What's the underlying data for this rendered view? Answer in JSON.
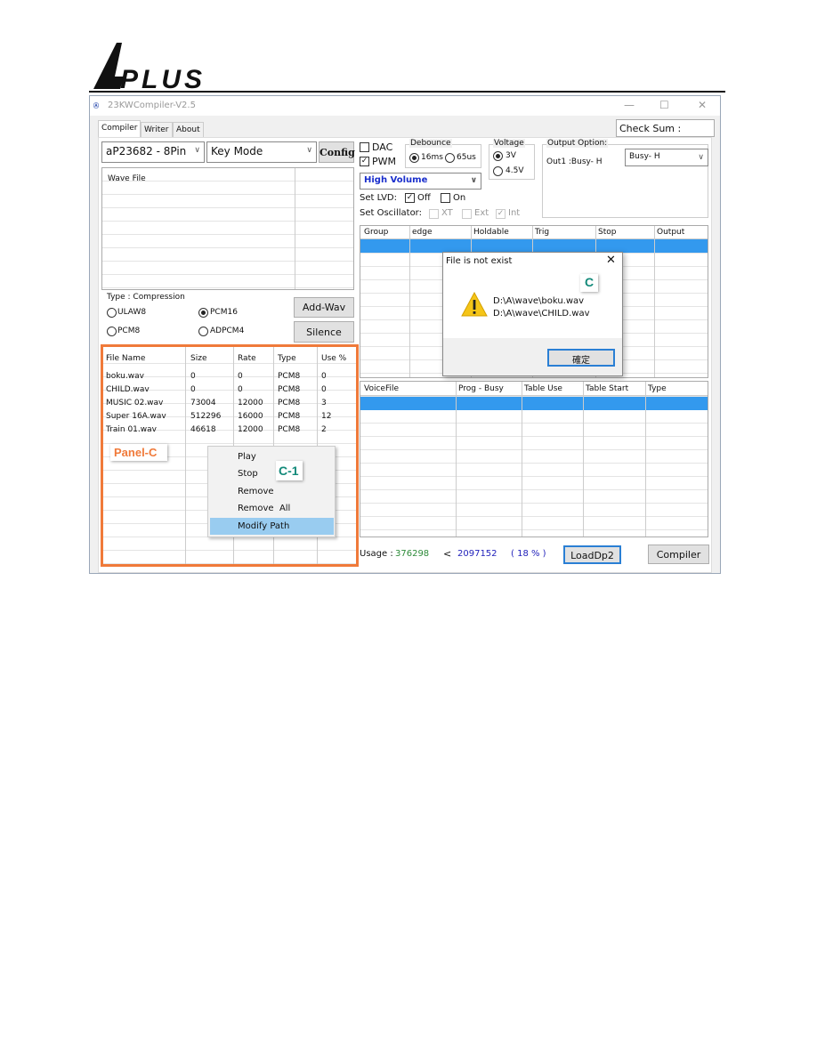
{
  "logo_text": "APLUS",
  "window": {
    "title": "23KWCompiler-V2.5",
    "minimize": "—",
    "maximize": "☐",
    "close": "✕"
  },
  "tabs": [
    {
      "label": "Compiler",
      "active": true
    },
    {
      "label": "Writer"
    },
    {
      "label": "About"
    }
  ],
  "check_sum_label": "Check Sum :",
  "chip_combo": "aP23682 - 8Pin",
  "mode_combo": "Key Mode",
  "config_label": "Config",
  "wave_file_header": "Wave File",
  "compression": {
    "title": "Type : Compression",
    "options": [
      {
        "label": "ULAW8",
        "checked": false
      },
      {
        "label": "PCM16",
        "checked": true
      },
      {
        "label": "PCM8",
        "checked": false
      },
      {
        "label": "ADPCM4",
        "checked": false
      }
    ]
  },
  "add_wav_label": "Add-Wav",
  "silence_label": "Silence",
  "file_table": {
    "headers": [
      "File Name",
      "Size",
      "Rate",
      "Type",
      "Use %"
    ],
    "rows": [
      [
        "boku.wav",
        "0",
        "0",
        "PCM8",
        "0"
      ],
      [
        "CHILD.wav",
        "0",
        "0",
        "PCM8",
        "0"
      ],
      [
        "MUSIC 02.wav",
        "73004",
        "12000",
        "PCM8",
        "3"
      ],
      [
        "Super 16A.wav",
        "512296",
        "16000",
        "PCM8",
        "12"
      ],
      [
        "Train 01.wav",
        "46618",
        "12000",
        "PCM8",
        "2"
      ]
    ]
  },
  "panel_c_tag": "Panel-C",
  "c1_tag": "C-1",
  "context_menu": [
    "Play",
    "Stop",
    "Remove",
    "Remove  All",
    "Modify Path"
  ],
  "context_menu_highlighted": "Modify Path",
  "dac": {
    "label": "DAC",
    "checked": false
  },
  "pwm": {
    "label": "PWM",
    "checked": true
  },
  "debounce": {
    "title": "Debounce",
    "options": [
      {
        "label": "16ms",
        "checked": true
      },
      {
        "label": "65us",
        "checked": false
      }
    ]
  },
  "voltage": {
    "title": "Voltage",
    "options": [
      {
        "label": "3V",
        "checked": true
      },
      {
        "label": "4.5V",
        "checked": false
      }
    ]
  },
  "output_option": {
    "title": "Output Option:",
    "out1": "Out1 :Busy- H",
    "combo": "Busy- H"
  },
  "volume_combo": "High Volume",
  "lvd": {
    "label": "Set LVD:",
    "off": "Off",
    "off_checked": true,
    "on": "On",
    "on_checked": false
  },
  "oscillator": {
    "label": "Set Oscillator:",
    "options": [
      {
        "label": "XT",
        "checked": false
      },
      {
        "label": "Ext",
        "checked": false
      },
      {
        "label": "Int",
        "checked": true
      }
    ]
  },
  "key_table": {
    "headers": [
      "Group",
      "edge",
      "Holdable",
      "Trig",
      "Stop",
      "Output"
    ]
  },
  "voice_table": {
    "headers": [
      "VoiceFile",
      "Prog - Busy",
      "Table Use",
      "Table Start",
      "Type"
    ]
  },
  "dialog": {
    "title": "File is not exist",
    "close": "✕",
    "lines": [
      "D:\\A\\wave\\boku.wav",
      "D:\\A\\wave\\CHILD.wav"
    ],
    "ok": "確定",
    "tag": "C"
  },
  "usage": {
    "label": "Usage :",
    "value": "376298",
    "lt": "<",
    "total": "2097152",
    "percent": "( 18 % )",
    "value_color": "#2e8b3a",
    "total_color": "#2222bb"
  },
  "loaddp2_label": "LoadDp2",
  "compiler_label": "Compiler",
  "colors": {
    "accent_orange": "#f07a3a",
    "selection_blue": "#3399ee",
    "tag_teal": "#138a7a"
  }
}
